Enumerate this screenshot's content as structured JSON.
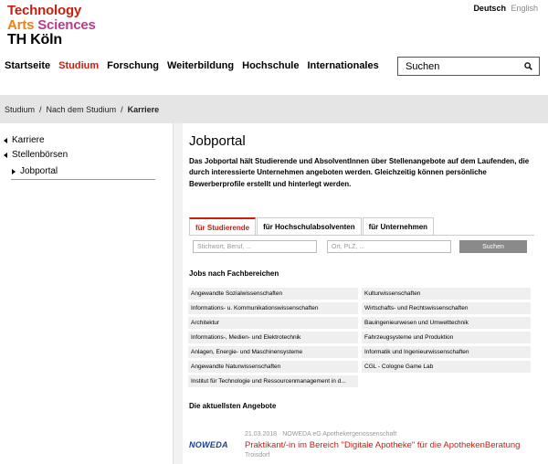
{
  "logo": {
    "line1": "Technology",
    "line2a": "Arts",
    "line2b": "Sciences",
    "line3": "TH Köln"
  },
  "lang": {
    "active": "Deutsch",
    "inactive": "English"
  },
  "nav": [
    {
      "label": "Startseite"
    },
    {
      "label": "Studium"
    },
    {
      "label": "Forschung"
    },
    {
      "label": "Weiterbildung"
    },
    {
      "label": "Hochschule"
    },
    {
      "label": "Internationales"
    }
  ],
  "search": {
    "placeholder": "Suchen"
  },
  "breadcrumb": {
    "item1": "Studium",
    "item2": "Nach dem Studium",
    "current": "Karriere"
  },
  "sidebar": {
    "item1": "Karriere",
    "item2": "Stellenbörsen",
    "item3": "Jobportal"
  },
  "page": {
    "title": "Jobportal",
    "intro": "Das Jobportal hält Studierende und AbsolventInnen über Stellenangebote auf dem Laufenden, die durch interessierte Unternehmen angeboten werden. Gleichzeitig können persönliche Bewerberprofile erstellt und hinterlegt werden."
  },
  "tabs": {
    "tab1": "für Studierende",
    "tab2": "für Hochschulabsolventen",
    "tab3": "für Unternehmen"
  },
  "jobsearch": {
    "keyword_placeholder": "Stichwort, Beruf, ...",
    "location_placeholder": "Ort, PLZ, ...",
    "button": "Suchen"
  },
  "fields_heading": "Jobs nach Fachbereichen",
  "fields": [
    "Angewandte Sozialwissenschaften",
    "Kulturwissenschaften",
    "Informations- u. Kommunikationswissenschaften",
    "Wirtschafts- und Rechtswissenschaften",
    "Architektur",
    "Bauingenieurwesen und Umwelttechnik",
    "Informations-, Medien- und Elektrotechnik",
    "Fahrzeugsysteme und Produktion",
    "Anlagen, Energie- und Maschinensysteme",
    "Informatik und Ingenieurwissenschaften",
    "Angewandte Naturwissenschaften",
    "CGL - Cologne Game Lab",
    "Institut für Technologie und Ressourcenmanagement in d..."
  ],
  "latest": {
    "heading": "Die aktuellsten Angebote",
    "logo_text": "NOWEDA",
    "meta": "21.03.2018 · NOWEDA eG Apothekergenossenschaft",
    "title": "Praktikant/-in im Bereich \"Digitale Apotheke\" für die ApothekenBeratung",
    "city": "Troisdorf"
  },
  "colors": {
    "brand_red": "#c81e0f",
    "brand_orange": "#e8821d",
    "brand_purple": "#b83c8a",
    "bar_gray": "#e5e5e5"
  },
  "icons": {
    "search": "magnifier-icon",
    "sidebar_back": "triangle-left-icon",
    "sidebar_current": "triangle-right-icon"
  }
}
